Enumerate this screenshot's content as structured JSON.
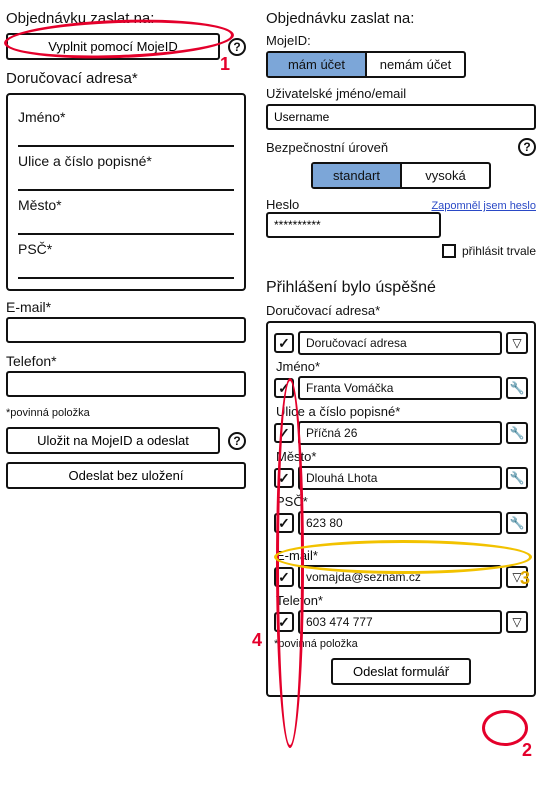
{
  "left": {
    "heading": "Objednávku zaslat na:",
    "mojeid_btn": "Vyplnit pomocí MojeID",
    "delivery_heading": "Doručovací adresa*",
    "fields": {
      "jmeno": "Jméno*",
      "ulice": "Ulice a číslo popisné*",
      "mesto": "Město*",
      "psc": "PSČ*",
      "email": "E-mail*",
      "telefon": "Telefon*"
    },
    "required_note": "*povinná položka",
    "save_btn": "Uložit na MojeID a odeslat",
    "send_btn": "Odeslat bez uložení"
  },
  "right_login": {
    "heading": "Objednávku zaslat na:",
    "mojeid_label": "MojeID:",
    "tab_have": "mám účet",
    "tab_not": "nemám účet",
    "user_label": "Uživatelské jméno/email",
    "username_value": "Username",
    "sec_label": "Bezpečnostní úroveň",
    "tab_standard": "standart",
    "tab_high": "vysoká",
    "pass_label": "Heslo",
    "forgot": "Zapomněl jsem heslo",
    "pass_value": "**********",
    "persist": "přihlásit trvale"
  },
  "right_success": {
    "heading": "Přihlášení bylo úspěšné",
    "delivery_heading": "Doručovací adresa*",
    "rows": {
      "adresa": {
        "label": "",
        "value": "Doručovací adresa"
      },
      "jmeno": {
        "label": "Jméno*",
        "value": "Franta Vomáčka"
      },
      "ulice": {
        "label": "Ulice a číslo popisné*",
        "value": "Příčná 26"
      },
      "mesto": {
        "label": "Město*",
        "value": "Dlouhá Lhota"
      },
      "psc": {
        "label": "PSČ*",
        "value": "623 80"
      },
      "email": {
        "label": "E-mail*",
        "value": "vomajda@seznam.cz"
      },
      "telefon": {
        "label": "Telefon*",
        "value": "603 474 777"
      }
    },
    "required_note": "*povinná položka",
    "submit_btn": "Odeslat formulář"
  },
  "annotations": {
    "n1": "1",
    "n2": "2",
    "n3": "3",
    "n4": "4"
  }
}
